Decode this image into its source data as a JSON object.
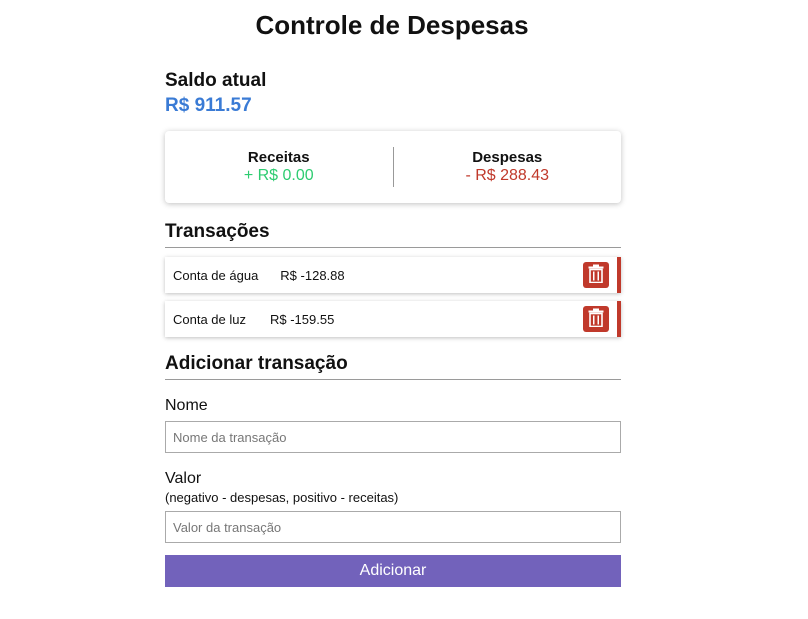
{
  "page": {
    "title": "Controle de Despesas"
  },
  "balance": {
    "label": "Saldo atual",
    "value": "R$ 911.57"
  },
  "summary": {
    "income_label": "Receitas",
    "income_value": "+ R$ 0.00",
    "expense_label": "Despesas",
    "expense_value": "- R$ 288.43"
  },
  "transactions": {
    "title": "Transações",
    "items": [
      {
        "name": "Conta de água",
        "amount": "R$ -128.88"
      },
      {
        "name": "Conta de luz",
        "amount": "R$ -159.55"
      }
    ],
    "delete_icon": "trash-icon"
  },
  "add_form": {
    "title": "Adicionar transação",
    "name_label": "Nome",
    "name_placeholder": "Nome da transação",
    "value_label": "Valor",
    "value_hint": "(negativo - despesas, positivo - receitas)",
    "value_placeholder": "Valor da transação",
    "submit_label": "Adicionar"
  },
  "colors": {
    "balance": "#3a7bd5",
    "income": "#2ecc71",
    "expense": "#c0392b",
    "delete_button": "#c0392b",
    "submit_button": "#7262bb"
  }
}
